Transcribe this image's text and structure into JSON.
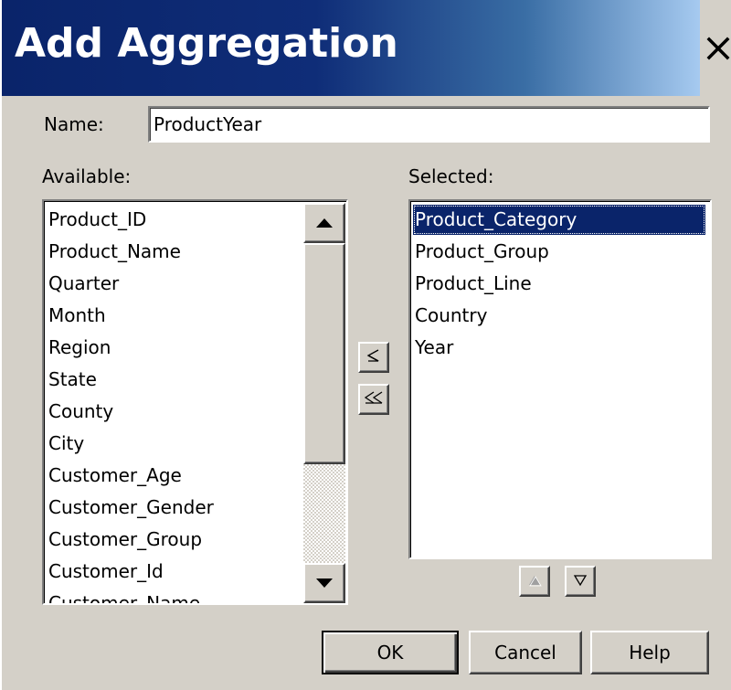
{
  "window": {
    "title": "Add Aggregation",
    "close_icon": "close-icon"
  },
  "form": {
    "name_label": "Name:",
    "name_value": "ProductYear",
    "available_label": "Available:",
    "selected_label": "Selected:"
  },
  "available": {
    "items": [
      "Product_ID",
      "Product_Name",
      "Quarter",
      "Month",
      "Region",
      "State",
      "County",
      "City",
      "Customer_Age",
      "Customer_Gender",
      "Customer_Group",
      "Customer_Id",
      "Customer_Name"
    ]
  },
  "selected": {
    "items": [
      "Product_Category",
      "Product_Group",
      "Product_Line",
      "Country",
      "Year"
    ],
    "selected_index": 0
  },
  "buttons": {
    "ok": "OK",
    "cancel": "Cancel",
    "help": "Help"
  },
  "colors": {
    "title_start": "#0a246a",
    "title_end": "#a6caf0",
    "selection": "#0a246a",
    "face": "#d4d0c8"
  }
}
